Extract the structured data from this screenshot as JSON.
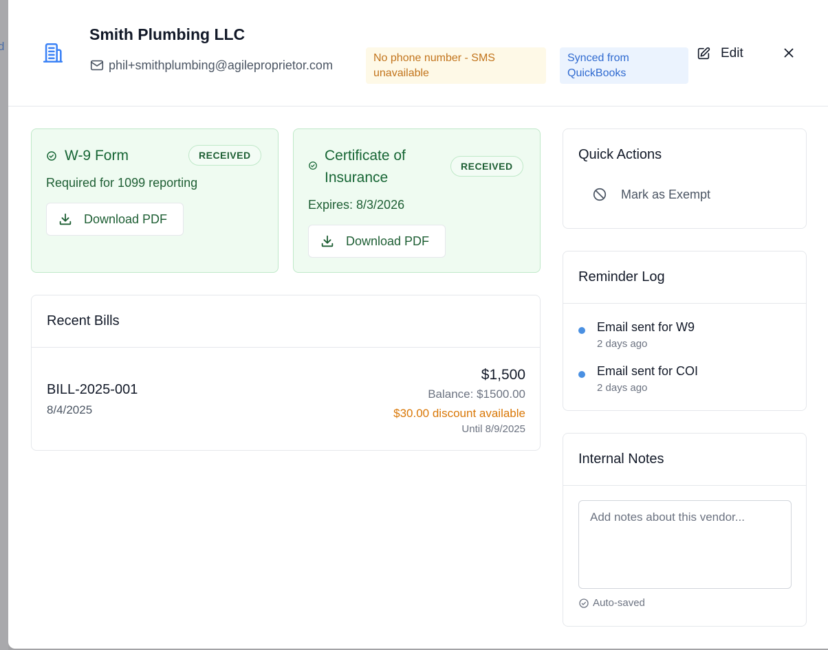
{
  "vendor": {
    "name": "Smith Plumbing LLC",
    "email": "phil+smithplumbing@agileproprietor.com",
    "badges": {
      "phone_warning": "No phone number - SMS unavailable",
      "sync": "Synced from QuickBooks"
    }
  },
  "header": {
    "edit_label": "Edit"
  },
  "documents": [
    {
      "title": "W-9 Form",
      "status": "RECEIVED",
      "subtitle": "Required for 1099 reporting",
      "download_label": "Download PDF"
    },
    {
      "title_line1": "Certificate of",
      "title_line2": "Insurance",
      "status": "RECEIVED",
      "subtitle": "Expires: 8/3/2026",
      "download_label": "Download PDF"
    }
  ],
  "recent_bills": {
    "title": "Recent Bills",
    "items": [
      {
        "id": "BILL-2025-001",
        "date": "8/4/2025",
        "amount": "$1,500",
        "balance": "Balance: $1500.00",
        "discount": "$30.00 discount available",
        "until": "Until 8/9/2025"
      }
    ]
  },
  "quick_actions": {
    "title": "Quick Actions",
    "mark_exempt_label": "Mark as Exempt"
  },
  "reminder_log": {
    "title": "Reminder Log",
    "items": [
      {
        "text": "Email sent for W9",
        "time": "2 days ago"
      },
      {
        "text": "Email sent for COI",
        "time": "2 days ago"
      }
    ]
  },
  "internal_notes": {
    "title": "Internal Notes",
    "placeholder": "Add notes about this vendor...",
    "value": "",
    "autosave_label": "Auto-saved"
  },
  "background": {
    "peek_text": "d"
  },
  "colors": {
    "accent_blue": "#3b82f6",
    "success_green": "#166534",
    "success_bg": "#effbf1",
    "warning_text": "#c2741c",
    "warning_bg": "#fef9e7",
    "sync_text": "#2f6ad0",
    "sync_bg": "#ebf3fe",
    "discount_orange": "#d97706",
    "log_dot": "#4a90e2"
  }
}
